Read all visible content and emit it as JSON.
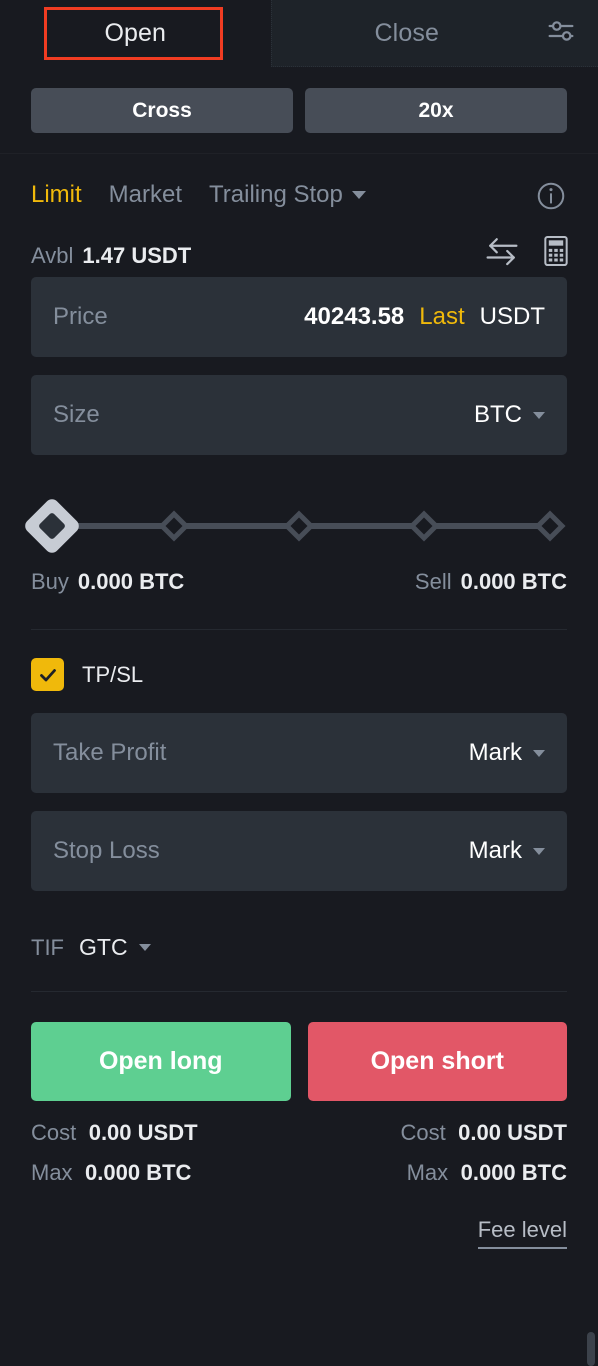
{
  "tabs": {
    "open_label": "Open",
    "close_label": "Close",
    "settings_icon": "sliders-settings-icon"
  },
  "margin": {
    "mode_label": "Cross",
    "leverage_label": "20x"
  },
  "order_types": {
    "limit_label": "Limit",
    "market_label": "Market",
    "trailing_stop_label": "Trailing Stop",
    "active": "Limit",
    "info_icon": "info-circle-icon"
  },
  "available": {
    "label": "Avbl",
    "value": "1.47 USDT",
    "swap_icon": "swap-arrows-icon",
    "calculator_icon": "calculator-icon"
  },
  "price": {
    "placeholder": "Price",
    "value": "40243.58",
    "mode_label": "Last",
    "unit": "USDT"
  },
  "size": {
    "placeholder": "Size",
    "unit": "BTC"
  },
  "slider": {
    "position_percent": 0,
    "ticks": [
      0,
      25,
      50,
      75,
      100
    ]
  },
  "amounts": {
    "buy_label": "Buy",
    "buy_value": "0.000 BTC",
    "sell_label": "Sell",
    "sell_value": "0.000 BTC"
  },
  "tpsl": {
    "label": "TP/SL",
    "checked": true,
    "take_profit_placeholder": "Take Profit",
    "take_profit_ref": "Mark",
    "stop_loss_placeholder": "Stop Loss",
    "stop_loss_ref": "Mark"
  },
  "tif": {
    "label": "TIF",
    "value": "GTC"
  },
  "actions": {
    "long_label": "Open long",
    "short_label": "Open short",
    "long_color": "#5ecf91",
    "short_color": "#e25767"
  },
  "footer": {
    "long": {
      "cost_label": "Cost",
      "cost_value": "0.00 USDT",
      "max_label": "Max",
      "max_value": "0.000 BTC"
    },
    "short": {
      "cost_label": "Cost",
      "cost_value": "0.00 USDT",
      "max_label": "Max",
      "max_value": "0.000 BTC"
    },
    "fee_level_label": "Fee level"
  }
}
